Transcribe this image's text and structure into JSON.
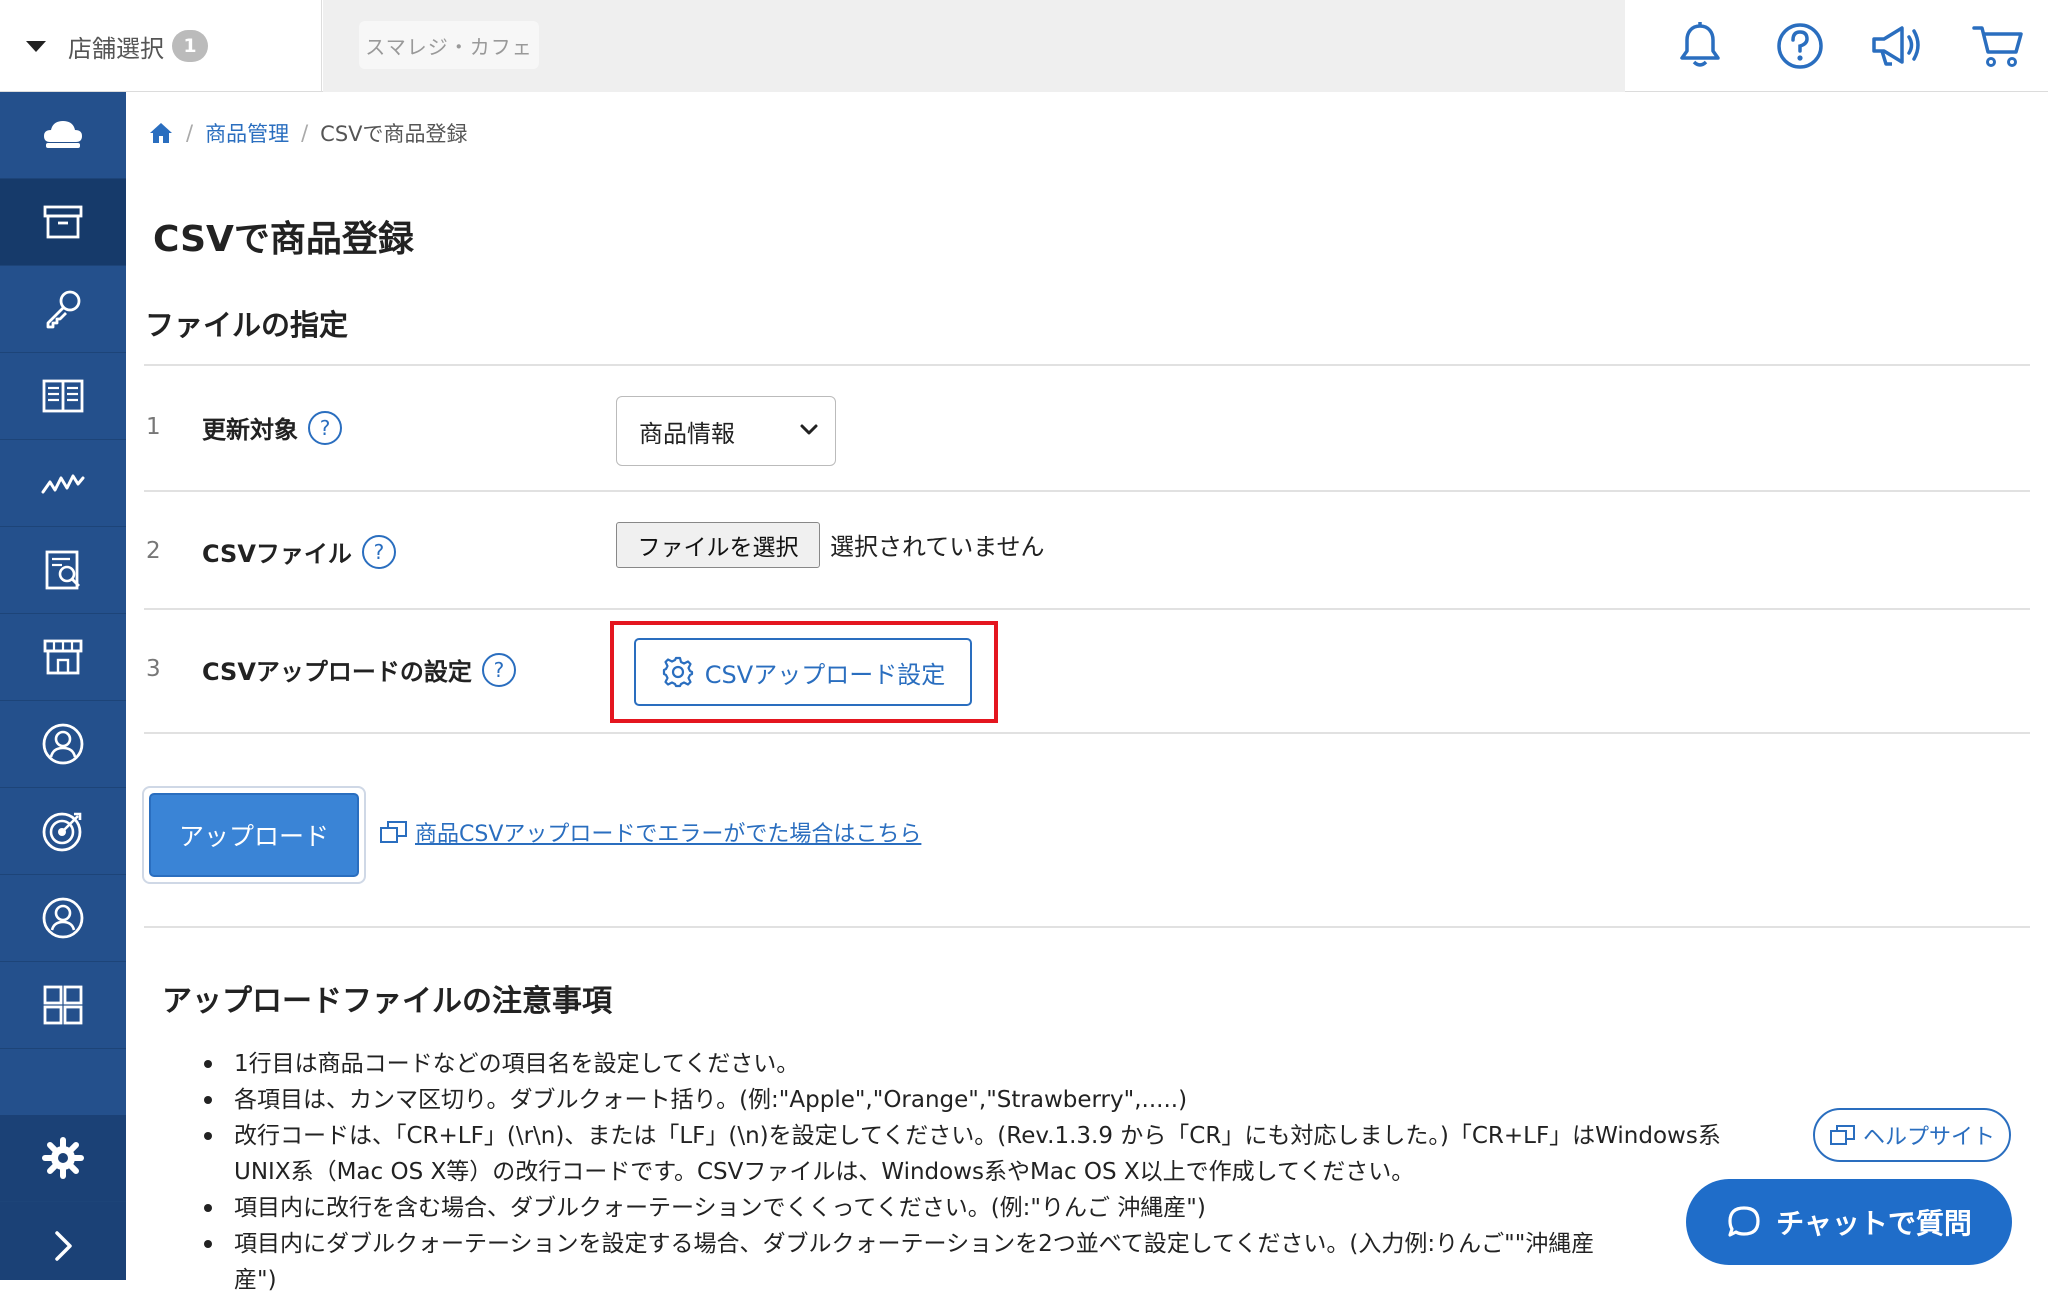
{
  "header": {
    "store_select_label": "店舗選択",
    "store_count": "1",
    "shop_name": "スマレジ・カフェ",
    "icons": [
      "bell-icon",
      "help-circle-icon",
      "megaphone-icon",
      "cart-icon"
    ]
  },
  "sidebar": {
    "icons": [
      "cloud-home-icon",
      "archive-box-icon",
      "key-icon",
      "book-icon",
      "chart-line-icon",
      "report-icon",
      "store-icon",
      "user-circle-icon",
      "target-icon",
      "user-icon",
      "grid-icon"
    ],
    "active_index": 1,
    "bottom_icons": [
      "gear-icon",
      "chevron-right-icon"
    ]
  },
  "breadcrumb": {
    "home_icon": "home-icon",
    "items": [
      "商品管理",
      "CSVで商品登録"
    ]
  },
  "page": {
    "title": "CSVで商品登録",
    "section_title": "ファイルの指定"
  },
  "form": {
    "rows": [
      {
        "num": "1",
        "label": "更新対象"
      },
      {
        "num": "2",
        "label": "CSVファイル"
      },
      {
        "num": "3",
        "label": "CSVアップロードの設定"
      }
    ],
    "help_glyph": "?",
    "target_selected": "商品情報",
    "file_button_label": "ファイルを選択",
    "file_status": "選択されていません",
    "csv_settings_label": "CSVアップロード設定",
    "upload_label": "アップロード",
    "error_link": "商品CSVアップロードでエラーがでた場合はこちら"
  },
  "notes": {
    "title": "アップロードファイルの注意事項",
    "items": [
      {
        "text": "1行目は商品コードなどの項目名を設定してください。"
      },
      {
        "text": "各項目は、カンマ区切り。ダブルクォート括り。(例:\"Apple\",\"Orange\",\"Strawberry\",.....)"
      },
      {
        "text": "改行コードは、「CR+LF」(\\r\\n)、または「LF」(\\n)を設定してください。(Rev.1.3.9 から「CR」にも対応しました。)「CR+LF」はWindows系",
        "cont": "UNIX系（Mac OS X等）の改行コードです。CSVファイルは、Windows系やMac OS X以上で作成してください。"
      },
      {
        "text": "項目内に改行を含む場合、ダブルクォーテーションでくくってください。(例:\"りんご 沖縄産\")"
      },
      {
        "text": "項目内にダブルクォーテーションを設定する場合、ダブルクォーテーションを2つ並べて設定してください。(入力例:りんご\"\"沖縄産",
        "cont": "産\")"
      }
    ]
  },
  "floating": {
    "help_site_label": "ヘルプサイト",
    "chat_label": "チャットで質問"
  },
  "colors": {
    "sidebar": "#24508c",
    "accent": "#2a6ebf",
    "highlight": "#e4161f",
    "chat": "#1f6dc9"
  }
}
